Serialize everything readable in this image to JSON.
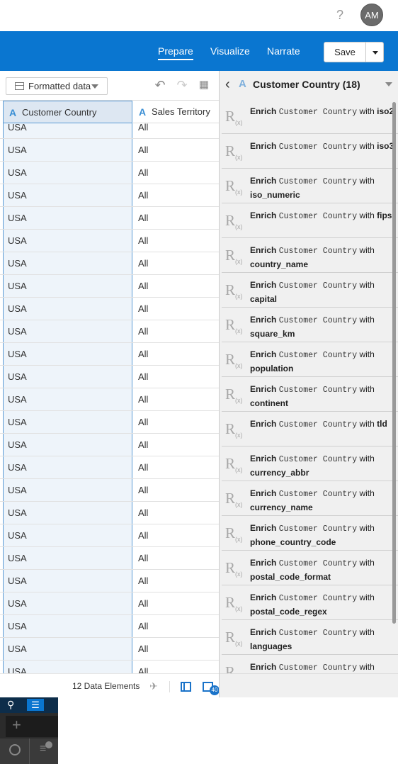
{
  "header": {
    "help_label": "?",
    "avatar_initials": "AM"
  },
  "nav": {
    "tabs": [
      "Prepare",
      "Visualize",
      "Narrate"
    ],
    "active_tab": "Prepare",
    "save_label": "Save"
  },
  "left": {
    "format_button": "Formatted data",
    "columns": [
      "Customer Country",
      "Sales Territory"
    ],
    "rows": [
      [
        "USA",
        "All"
      ],
      [
        "USA",
        "All"
      ],
      [
        "USA",
        "All"
      ],
      [
        "USA",
        "All"
      ],
      [
        "USA",
        "All"
      ],
      [
        "USA",
        "All"
      ],
      [
        "USA",
        "All"
      ],
      [
        "USA",
        "All"
      ],
      [
        "USA",
        "All"
      ],
      [
        "USA",
        "All"
      ],
      [
        "USA",
        "All"
      ],
      [
        "USA",
        "All"
      ],
      [
        "USA",
        "All"
      ],
      [
        "USA",
        "All"
      ],
      [
        "USA",
        "All"
      ],
      [
        "USA",
        "All"
      ],
      [
        "USA",
        "All"
      ],
      [
        "USA",
        "All"
      ],
      [
        "USA",
        "All"
      ],
      [
        "USA",
        "All"
      ],
      [
        "USA",
        "All"
      ],
      [
        "USA",
        "All"
      ],
      [
        "USA",
        "All"
      ],
      [
        "USA",
        "All"
      ],
      [
        "USA",
        "All"
      ]
    ],
    "status_text": "12 Data Elements",
    "badge_count": "40"
  },
  "right": {
    "title": "Customer Country (18)",
    "recommendations": [
      {
        "verb": "Enrich",
        "column": "Customer Country",
        "with": "with",
        "attr": "iso2"
      },
      {
        "verb": "Enrich",
        "column": "Customer Country",
        "with": "with",
        "attr": "iso3"
      },
      {
        "verb": "Enrich",
        "column": "Customer Country",
        "with": "with",
        "attr": "iso_numeric"
      },
      {
        "verb": "Enrich",
        "column": "Customer Country",
        "with": "with",
        "attr": "fips"
      },
      {
        "verb": "Enrich",
        "column": "Customer Country",
        "with": "with",
        "attr": "country_name"
      },
      {
        "verb": "Enrich",
        "column": "Customer Country",
        "with": "with",
        "attr": "capital"
      },
      {
        "verb": "Enrich",
        "column": "Customer Country",
        "with": "with",
        "attr": "square_km"
      },
      {
        "verb": "Enrich",
        "column": "Customer Country",
        "with": "with",
        "attr": "population"
      },
      {
        "verb": "Enrich",
        "column": "Customer Country",
        "with": "with",
        "attr": "continent"
      },
      {
        "verb": "Enrich",
        "column": "Customer Country",
        "with": "with",
        "attr": "tld"
      },
      {
        "verb": "Enrich",
        "column": "Customer Country",
        "with": "with",
        "attr": "currency_abbr"
      },
      {
        "verb": "Enrich",
        "column": "Customer Country",
        "with": "with",
        "attr": "currency_name"
      },
      {
        "verb": "Enrich",
        "column": "Customer Country",
        "with": "with",
        "attr": "phone_country_code"
      },
      {
        "verb": "Enrich",
        "column": "Customer Country",
        "with": "with",
        "attr": "postal_code_format"
      },
      {
        "verb": "Enrich",
        "column": "Customer Country",
        "with": "with",
        "attr": "postal_code_regex"
      },
      {
        "verb": "Enrich",
        "column": "Customer Country",
        "with": "with",
        "attr": "languages"
      },
      {
        "verb": "Enrich",
        "column": "Customer Country",
        "with": "with",
        "attr": ""
      }
    ]
  },
  "colors": {
    "brand_blue": "#0a76d0",
    "selected_column_bg": "#dde7f2",
    "selected_border": "#5b9bd5"
  }
}
